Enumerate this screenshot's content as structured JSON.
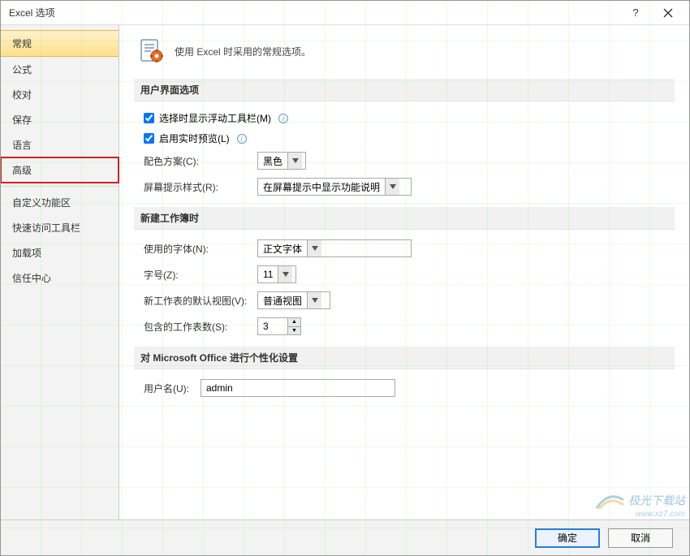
{
  "titlebar": {
    "title": "Excel 选项"
  },
  "sidebar": {
    "items": [
      {
        "label": "常规"
      },
      {
        "label": "公式"
      },
      {
        "label": "校对"
      },
      {
        "label": "保存"
      },
      {
        "label": "语言"
      },
      {
        "label": "高级"
      },
      {
        "label": "自定义功能区"
      },
      {
        "label": "快速访问工具栏"
      },
      {
        "label": "加载项"
      },
      {
        "label": "信任中心"
      }
    ]
  },
  "intro": {
    "text": "使用 Excel 时采用的常规选项。"
  },
  "section_ui": {
    "header": "用户界面选项",
    "cb_floating": "选择时显示浮动工具栏(M)",
    "cb_livepreview": "启用实时预览(L)",
    "color_scheme_label": "配色方案(C):",
    "color_scheme_value": "黑色",
    "screentip_label": "屏幕提示样式(R):",
    "screentip_value": "在屏幕提示中显示功能说明"
  },
  "section_newwb": {
    "header": "新建工作簿时",
    "font_label": "使用的字体(N):",
    "font_value": "正文字体",
    "fontsize_label": "字号(Z):",
    "fontsize_value": "11",
    "defaultview_label": "新工作表的默认视图(V):",
    "defaultview_value": "普通视图",
    "sheetcount_label": "包含的工作表数(S):",
    "sheetcount_value": "3"
  },
  "section_personal": {
    "header": "对 Microsoft Office 进行个性化设置",
    "username_label": "用户名(U):",
    "username_value": "admin"
  },
  "footer": {
    "ok": "确定",
    "cancel": "取消"
  },
  "watermark": {
    "main": "极光下载站",
    "sub": "www.xz7.com"
  }
}
